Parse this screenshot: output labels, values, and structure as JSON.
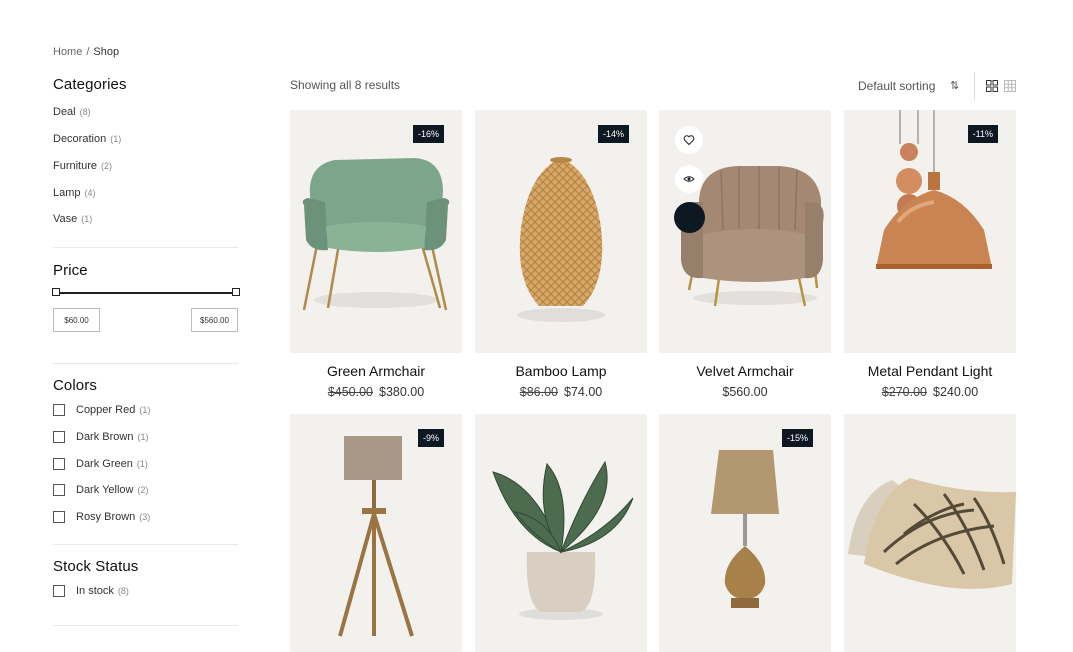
{
  "breadcrumb": {
    "home": "Home",
    "separator": "/",
    "current": "Shop"
  },
  "sidebar": {
    "categories_title": "Categories",
    "categories": [
      {
        "label": "Deal",
        "count": "(8)"
      },
      {
        "label": "Decoration",
        "count": "(1)"
      },
      {
        "label": "Furniture",
        "count": "(2)"
      },
      {
        "label": "Lamp",
        "count": "(4)"
      },
      {
        "label": "Vase",
        "count": "(1)"
      }
    ],
    "price_title": "Price",
    "price_min": "$60.00",
    "price_max": "$560.00",
    "colors_title": "Colors",
    "colors": [
      {
        "label": "Copper Red",
        "count": "(1)"
      },
      {
        "label": "Dark Brown",
        "count": "(1)"
      },
      {
        "label": "Dark Green",
        "count": "(1)"
      },
      {
        "label": "Dark Yellow",
        "count": "(2)"
      },
      {
        "label": "Rosy Brown",
        "count": "(3)"
      }
    ],
    "stock_title": "Stock Status",
    "stock": [
      {
        "label": "In stock",
        "count": "(8)"
      }
    ]
  },
  "toolbar": {
    "results": "Showing all 8 results",
    "sort": "Default sorting",
    "sort_icon": "⇅"
  },
  "products": [
    {
      "name": "Green Armchair",
      "old_price": "$450.00",
      "price": "$380.00",
      "badge": "-16%"
    },
    {
      "name": "Bamboo Lamp",
      "old_price": "$86.00",
      "price": "$74.00",
      "badge": "-14%"
    },
    {
      "name": "Velvet Armchair",
      "old_price": "",
      "price": "$560.00",
      "badge": ""
    },
    {
      "name": "Metal Pendant Light",
      "old_price": "$270.00",
      "price": "$240.00",
      "badge": "-11%"
    },
    {
      "name": "",
      "old_price": "",
      "price": "",
      "badge": "-9%"
    },
    {
      "name": "",
      "old_price": "",
      "price": "",
      "badge": ""
    },
    {
      "name": "",
      "old_price": "",
      "price": "",
      "badge": "-15%"
    },
    {
      "name": "",
      "old_price": "",
      "price": "",
      "badge": ""
    }
  ],
  "colors": {
    "accent": "#0e1823",
    "card_bg": "#f3f1ed"
  }
}
